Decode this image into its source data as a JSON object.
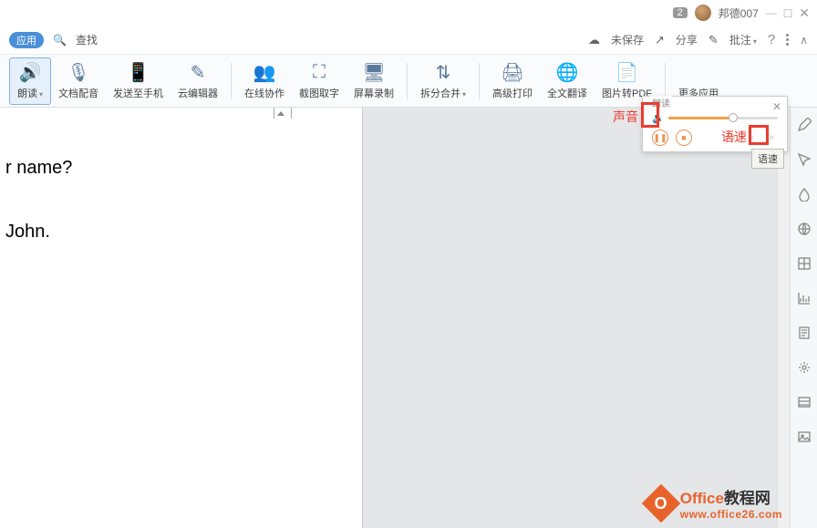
{
  "titlebar": {
    "badge": "2",
    "username": "邦德007"
  },
  "topbar": {
    "app_tag": "应用",
    "search": "查找",
    "unsaved": "未保存",
    "share": "分享",
    "review": "批注",
    "review_arrow": "▾"
  },
  "ribbon": {
    "read": "朗读",
    "read_arrow": "▾",
    "audio": "文档配音",
    "send": "发送至手机",
    "cloud": "云编辑器",
    "collab": "在线协作",
    "screenshot": "截图取字",
    "record": "屏幕录制",
    "split": "拆分合并",
    "split_arrow": "▾",
    "print": "高级打印",
    "translate": "全文翻译",
    "pdf": "图片转PDF",
    "more": "更多应用"
  },
  "document": {
    "line1": "r name?",
    "line2": "John."
  },
  "panel": {
    "title": "朗读",
    "tooltip": "语速"
  },
  "annotations": {
    "sound": "声音",
    "speed": "语速"
  },
  "watermark": {
    "brand_orange": "Office",
    "brand_black": "教程网",
    "url": "www.office26.com"
  }
}
